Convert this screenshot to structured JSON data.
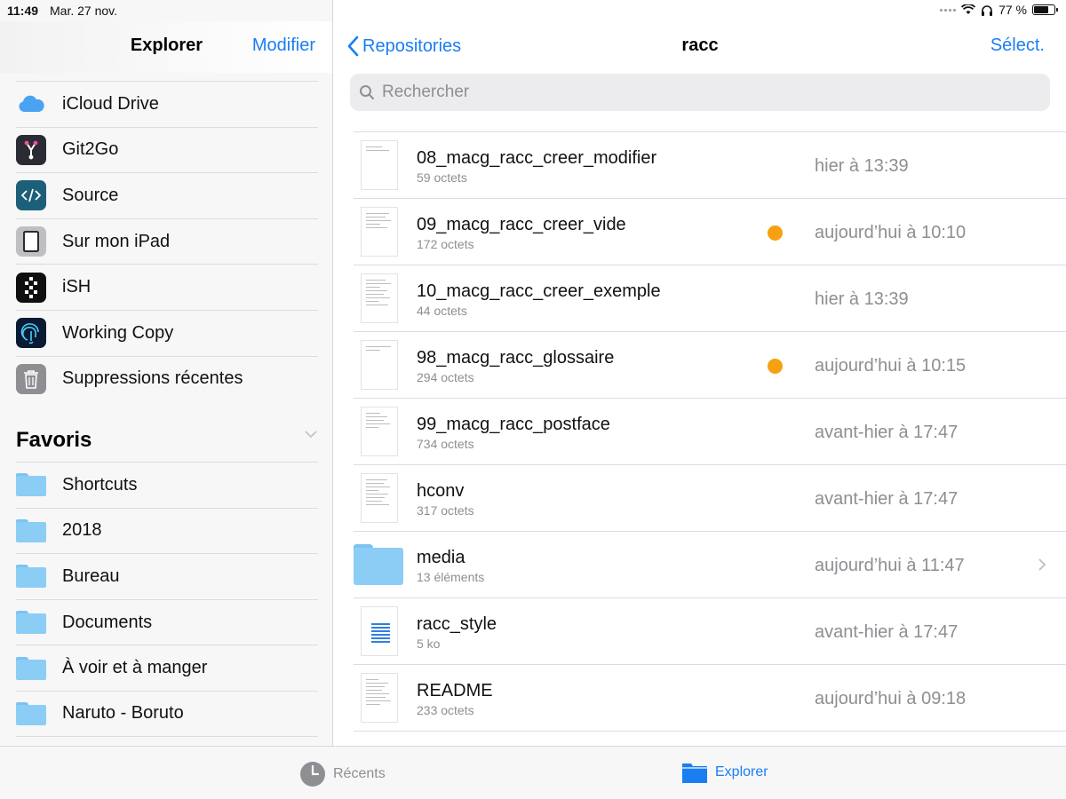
{
  "status_bar": {
    "time": "11:49",
    "date": "Mar. 27 nov.",
    "battery": "77 %",
    "battery_level": 0.77
  },
  "sidebar": {
    "title": "Explorer",
    "edit_label": "Modifier",
    "locations": [
      {
        "label": "iCloud Drive",
        "icon": "cloud-icon"
      },
      {
        "label": "Git2Go",
        "icon": "git2go-app-icon"
      },
      {
        "label": "Source",
        "icon": "source-app-icon"
      },
      {
        "label": "Sur mon iPad",
        "icon": "ipad-icon"
      },
      {
        "label": "iSH",
        "icon": "ish-app-icon"
      },
      {
        "label": "Working Copy",
        "icon": "fingerprint-icon"
      },
      {
        "label": "Suppressions récentes",
        "icon": "trash-icon"
      }
    ],
    "favorites_title": "Favoris",
    "favorites": [
      {
        "label": "Shortcuts"
      },
      {
        "label": "2018"
      },
      {
        "label": "Bureau"
      },
      {
        "label": "Documents"
      },
      {
        "label": "À voir et à manger"
      },
      {
        "label": "Naruto - Boruto"
      }
    ]
  },
  "main": {
    "back_label": "Repositories",
    "title": "racc",
    "select_label": "Sélect.",
    "search_placeholder": "Rechercher",
    "files": [
      {
        "name": "08_macg_racc_creer_modifier",
        "size": "59 octets",
        "date": "hier à 13:39",
        "dot": false,
        "kind": "text"
      },
      {
        "name": "09_macg_racc_creer_vide",
        "size": "172 octets",
        "date": "aujourd’hui à 10:10",
        "dot": true,
        "kind": "text"
      },
      {
        "name": "10_macg_racc_creer_exemple",
        "size": "44 octets",
        "date": "hier à 13:39",
        "dot": false,
        "kind": "text"
      },
      {
        "name": "98_macg_racc_glossaire",
        "size": "294 octets",
        "date": "aujourd’hui à 10:15",
        "dot": true,
        "kind": "text"
      },
      {
        "name": "99_macg_racc_postface",
        "size": "734 octets",
        "date": "avant-hier à 17:47",
        "dot": false,
        "kind": "text"
      },
      {
        "name": "hconv",
        "size": "317 octets",
        "date": "avant-hier à 17:47",
        "dot": false,
        "kind": "text"
      },
      {
        "name": "media",
        "size": "13 éléments",
        "date": "aujourd’hui à 11:47",
        "dot": false,
        "kind": "folder"
      },
      {
        "name": "racc_style",
        "size": "5 ko",
        "date": "avant-hier à 17:47",
        "dot": false,
        "kind": "doc"
      },
      {
        "name": "README",
        "size": "233 octets",
        "date": "aujourd’hui à 09:18",
        "dot": false,
        "kind": "text"
      }
    ],
    "status_dot_color": "#f6a111"
  },
  "tabbar": {
    "recent_label": "Récents",
    "explore_label": "Explorer"
  },
  "colors": {
    "accent": "#1a7ef2",
    "folder": "#8ccdf6",
    "secondary_text": "#8e8e93"
  }
}
